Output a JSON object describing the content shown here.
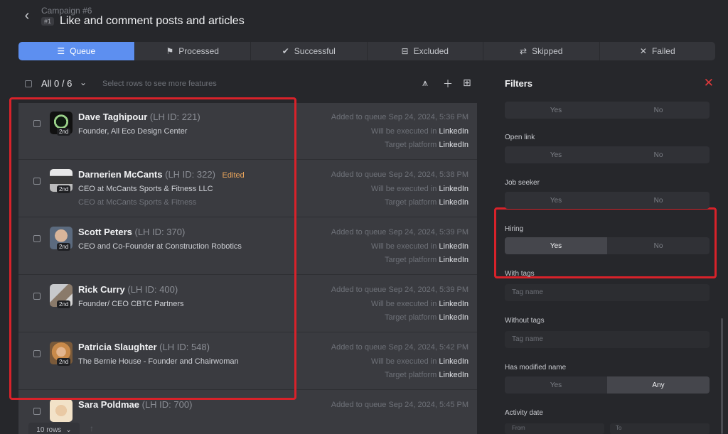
{
  "header": {
    "campaign_label": "Campaign #6",
    "step_badge": "#1",
    "title": "Like and comment posts and articles"
  },
  "tabs": [
    {
      "label": "Queue",
      "icon": "stack-icon",
      "active": true
    },
    {
      "label": "Processed",
      "icon": "flag-icon",
      "active": false
    },
    {
      "label": "Successful",
      "icon": "check-icon",
      "active": false
    },
    {
      "label": "Excluded",
      "icon": "excluded-icon",
      "active": false
    },
    {
      "label": "Skipped",
      "icon": "skip-icon",
      "active": false
    },
    {
      "label": "Failed",
      "icon": "x-icon",
      "active": false
    }
  ],
  "toolbar": {
    "all_label": "All 0 / 6",
    "hint": "Select rows to see more features"
  },
  "rows": [
    {
      "name": "Dave Taghipour",
      "lhid": "(LH ID: 221)",
      "edited": "",
      "title": "Founder, All Eco Design Center",
      "subtitle": "",
      "degree": "2nd",
      "added": "Added to queue Sep 24, 2024, 5:36 PM",
      "exec_prefix": "Will be executed in",
      "exec_val": "LinkedIn",
      "target_prefix": "Target platform",
      "target_val": "LinkedIn"
    },
    {
      "name": "Darnerien McCants",
      "lhid": "(LH ID: 322)",
      "edited": "Edited",
      "title": "CEO at McCants Sports & Fitness LLC",
      "subtitle": "CEO at McCants Sports & Fitness",
      "degree": "2nd",
      "added": "Added to queue Sep 24, 2024, 5:38 PM",
      "exec_prefix": "Will be executed in",
      "exec_val": "LinkedIn",
      "target_prefix": "Target platform",
      "target_val": "LinkedIn"
    },
    {
      "name": "Scott Peters",
      "lhid": "(LH ID: 370)",
      "edited": "",
      "title": "CEO and Co-Founder at Construction Robotics",
      "subtitle": "",
      "degree": "2nd",
      "added": "Added to queue Sep 24, 2024, 5:39 PM",
      "exec_prefix": "Will be executed in",
      "exec_val": "LinkedIn",
      "target_prefix": "Target platform",
      "target_val": "LinkedIn"
    },
    {
      "name": "Rick Curry",
      "lhid": "(LH ID: 400)",
      "edited": "",
      "title": "Founder/ CEO CBTC Partners",
      "subtitle": "",
      "degree": "2nd",
      "added": "Added to queue Sep 24, 2024, 5:39 PM",
      "exec_prefix": "Will be executed in",
      "exec_val": "LinkedIn",
      "target_prefix": "Target platform",
      "target_val": "LinkedIn"
    },
    {
      "name": "Patricia Slaughter",
      "lhid": "(LH ID: 548)",
      "edited": "",
      "title": "The Bernie House - Founder and Chairwoman",
      "subtitle": "",
      "degree": "2nd",
      "added": "Added to queue Sep 24, 2024, 5:42 PM",
      "exec_prefix": "Will be executed in",
      "exec_val": "LinkedIn",
      "target_prefix": "Target platform",
      "target_val": "LinkedIn"
    },
    {
      "name": "Sara Poldmae",
      "lhid": "(LH ID: 700)",
      "edited": "",
      "title": "",
      "subtitle": "",
      "degree": "",
      "added": "Added to queue Sep 24, 2024, 5:45 PM",
      "exec_prefix": "",
      "exec_val": "",
      "target_prefix": "",
      "target_val": ""
    }
  ],
  "pagination": {
    "rows_label": "10 rows"
  },
  "filters": {
    "title": "Filters",
    "yes": "Yes",
    "no": "No",
    "any": "Any",
    "open_link": "Open link",
    "job_seeker": "Job seeker",
    "hiring": "Hiring",
    "with_tags": "With tags",
    "without_tags": "Without tags",
    "tag_placeholder": "Tag name",
    "has_modified_name": "Has modified name",
    "activity_date": "Activity date",
    "from": "From",
    "to": "To",
    "hiring_selected": "Yes",
    "modified_name_selected": "Any"
  },
  "colors": {
    "accent": "#5d8ff0",
    "highlight_red": "#d8222a",
    "edited": "#e8a45b"
  }
}
